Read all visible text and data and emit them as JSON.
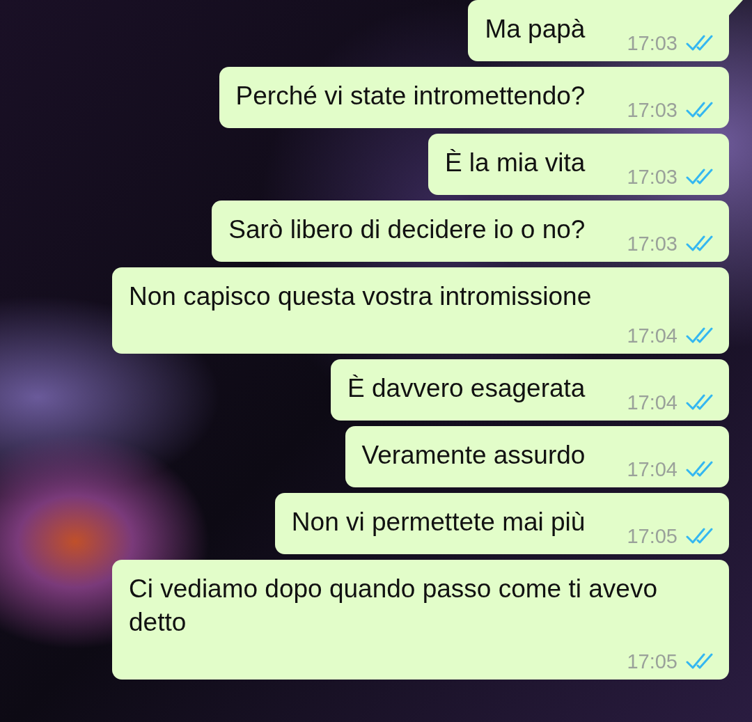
{
  "messages": [
    {
      "text": "Ma papà",
      "time": "17:03",
      "read": true,
      "tail": true
    },
    {
      "text": "Perché vi state intromettendo?",
      "time": "17:03",
      "read": true,
      "tail": false
    },
    {
      "text": "È la mia vita",
      "time": "17:03",
      "read": true,
      "tail": false
    },
    {
      "text": "Sarò libero di decidere io o no?",
      "time": "17:03",
      "read": true,
      "tail": false
    },
    {
      "text": "Non capisco questa vostra intromissione",
      "time": "17:04",
      "read": true,
      "tail": false
    },
    {
      "text": "È davvero esagerata",
      "time": "17:04",
      "read": true,
      "tail": false
    },
    {
      "text": "Veramente assurdo",
      "time": "17:04",
      "read": true,
      "tail": false
    },
    {
      "text": "Non vi permettete mai più",
      "time": "17:05",
      "read": true,
      "tail": false
    },
    {
      "text": "Ci vediamo dopo quando passo come ti avevo detto",
      "time": "17:05",
      "read": true,
      "tail": false
    }
  ]
}
